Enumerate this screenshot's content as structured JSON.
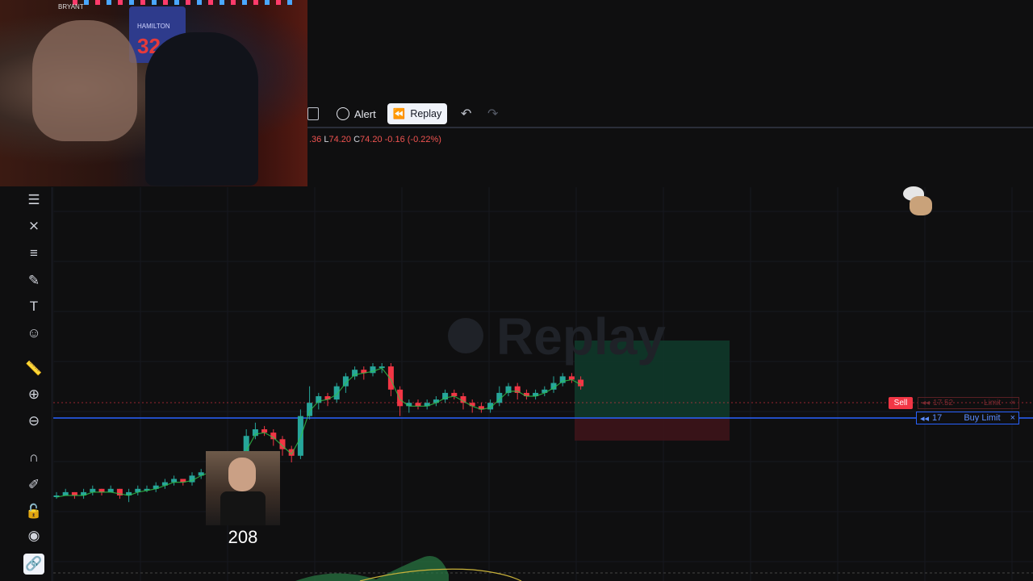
{
  "toolbar": {
    "alert_label": "Alert",
    "replay_label": "Replay"
  },
  "ohlc": {
    "open_partial": ".36",
    "low_key": "L",
    "low": "74.20",
    "close_key": "C",
    "close": "74.20",
    "change": "-0.16 (-0.22%)"
  },
  "watermark": "Replay",
  "orders": {
    "sell_tag": "Sell",
    "sell_qty": "17.52",
    "sell_type": "Limit",
    "buy_qty": "17",
    "buy_type": "Buy Limit",
    "close_glyph": "×",
    "arrow_glyph": "◂◂"
  },
  "webcam": {
    "jersey_name": "HAMILTON",
    "jersey_number": "32",
    "banner_name": "BRYANT"
  },
  "overlay": {
    "counter": "208"
  },
  "left_toolbar": [
    "menu-icon",
    "pattern-icon",
    "fib-icon",
    "brush-icon",
    "text-icon",
    "emoji-icon",
    "ruler-icon",
    "zoom-in-icon",
    "zoom-out-icon",
    "magnet-icon",
    "pencil-lock-icon",
    "lock-icon",
    "eye-icon",
    "link-icon"
  ],
  "chart_data": {
    "type": "candlestick",
    "colors": {
      "up": "#26a69a",
      "down": "#f23645",
      "ma": "#2fbf4a",
      "sell_line": "#f23645",
      "buy_line": "#2962ff"
    },
    "candles": [
      [
        0,
        0,
        1,
        -1,
        0
      ],
      [
        0,
        1,
        2,
        0,
        1
      ],
      [
        1,
        0,
        1,
        -1,
        -1
      ],
      [
        0,
        1,
        2,
        -1,
        1
      ],
      [
        1,
        2,
        3,
        0,
        1
      ],
      [
        2,
        1,
        2,
        0,
        -1
      ],
      [
        1,
        2,
        3,
        1,
        1
      ],
      [
        2,
        0,
        2,
        -1,
        -1
      ],
      [
        0,
        1,
        2,
        -2,
        1
      ],
      [
        1,
        2,
        3,
        0,
        1
      ],
      [
        2,
        2,
        3,
        1,
        0
      ],
      [
        2,
        3,
        4,
        1,
        1
      ],
      [
        3,
        4,
        5,
        2,
        1
      ],
      [
        4,
        5,
        6,
        3,
        1
      ],
      [
        5,
        4,
        5,
        3,
        -1
      ],
      [
        4,
        6,
        7,
        3,
        1
      ],
      [
        6,
        7,
        8,
        5,
        1
      ],
      [
        7,
        8,
        9,
        6,
        1
      ],
      [
        8,
        9,
        10,
        7,
        1
      ],
      [
        9,
        8,
        9,
        7,
        -1
      ],
      [
        8,
        10,
        11,
        7,
        1
      ],
      [
        10,
        18,
        20,
        9,
        1
      ],
      [
        18,
        20,
        22,
        17,
        1
      ],
      [
        20,
        19,
        21,
        18,
        -1
      ],
      [
        19,
        17,
        20,
        15,
        -1
      ],
      [
        17,
        14,
        18,
        12,
        -1
      ],
      [
        14,
        12,
        15,
        10,
        -1
      ],
      [
        12,
        24,
        26,
        11,
        1
      ],
      [
        24,
        28,
        33,
        23,
        1
      ],
      [
        28,
        30,
        31,
        26,
        1
      ],
      [
        30,
        29,
        31,
        27,
        -1
      ],
      [
        29,
        33,
        34,
        28,
        1
      ],
      [
        33,
        36,
        37,
        31,
        1
      ],
      [
        36,
        38,
        39,
        35,
        1
      ],
      [
        38,
        37,
        39,
        35,
        -1
      ],
      [
        37,
        39,
        40,
        36,
        1
      ],
      [
        39,
        39,
        40,
        37,
        0
      ],
      [
        39,
        32,
        40,
        30,
        -1
      ],
      [
        32,
        27,
        33,
        24,
        -1
      ],
      [
        27,
        28,
        29,
        25,
        1
      ],
      [
        28,
        27,
        29,
        26,
        -1
      ],
      [
        27,
        28,
        29,
        26,
        1
      ],
      [
        28,
        29,
        30,
        27,
        1
      ],
      [
        29,
        31,
        32,
        28,
        1
      ],
      [
        31,
        30,
        32,
        29,
        -1
      ],
      [
        30,
        28,
        31,
        26,
        -1
      ],
      [
        28,
        27,
        29,
        25,
        -1
      ],
      [
        27,
        26,
        28,
        25,
        -1
      ],
      [
        26,
        28,
        29,
        25,
        1
      ],
      [
        28,
        31,
        33,
        27,
        1
      ],
      [
        31,
        33,
        34,
        30,
        1
      ],
      [
        33,
        31,
        34,
        29,
        -1
      ],
      [
        31,
        30,
        32,
        29,
        -1
      ],
      [
        30,
        31,
        32,
        29,
        1
      ],
      [
        31,
        32,
        33,
        30,
        1
      ],
      [
        32,
        34,
        36,
        31,
        1
      ],
      [
        34,
        36,
        37,
        33,
        1
      ],
      [
        36,
        35,
        37,
        34,
        -1
      ],
      [
        35,
        33,
        36,
        32,
        -1
      ]
    ],
    "sell_limit_price": "17.52",
    "buy_limit_qty": "17",
    "last_close": "74.20"
  }
}
